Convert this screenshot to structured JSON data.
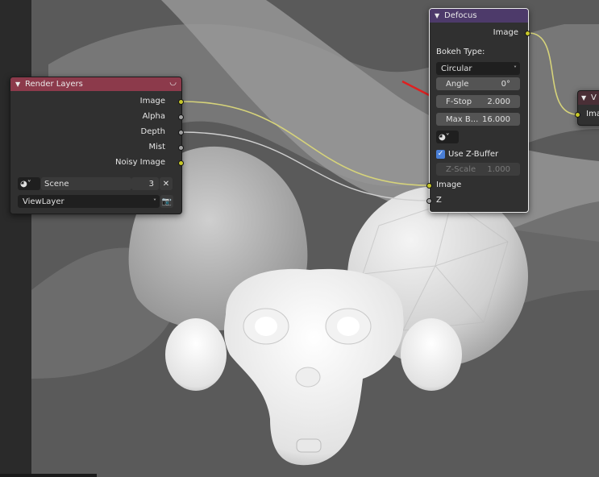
{
  "render_layers": {
    "title": "Render Layers",
    "outputs": [
      "Image",
      "Alpha",
      "Depth",
      "Mist",
      "Noisy Image"
    ],
    "scene_name": "Scene",
    "scene_users": "3",
    "view_layer": "ViewLayer"
  },
  "defocus": {
    "title": "Defocus",
    "output_image": "Image",
    "bokeh_type_label": "Bokeh Type:",
    "bokeh_type_value": "Circular",
    "angle_label": "Angle",
    "angle_value": "0°",
    "fstop_label": "F-Stop",
    "fstop_value": "2.000",
    "maxblur_label": "Max B...",
    "maxblur_value": "16.000",
    "use_zbuffer_label": "Use Z-Buffer",
    "use_zbuffer_checked": true,
    "zscale_label": "Z-Scale",
    "zscale_value": "1.000",
    "input_image": "Image",
    "input_z": "Z"
  },
  "viewer": {
    "title": "V",
    "input_image": "Ima"
  },
  "colors": {
    "render_layers_header": "#8c3a4b",
    "defocus_header": "#4d3a6a",
    "viewer_header": "#4a2f36",
    "wire_image": "#d6d37a",
    "wire_gray": "#cfcfcf",
    "socket_image": "#c7c729",
    "socket_value": "#a1a1a1",
    "annotation_arrow": "#e02020"
  }
}
